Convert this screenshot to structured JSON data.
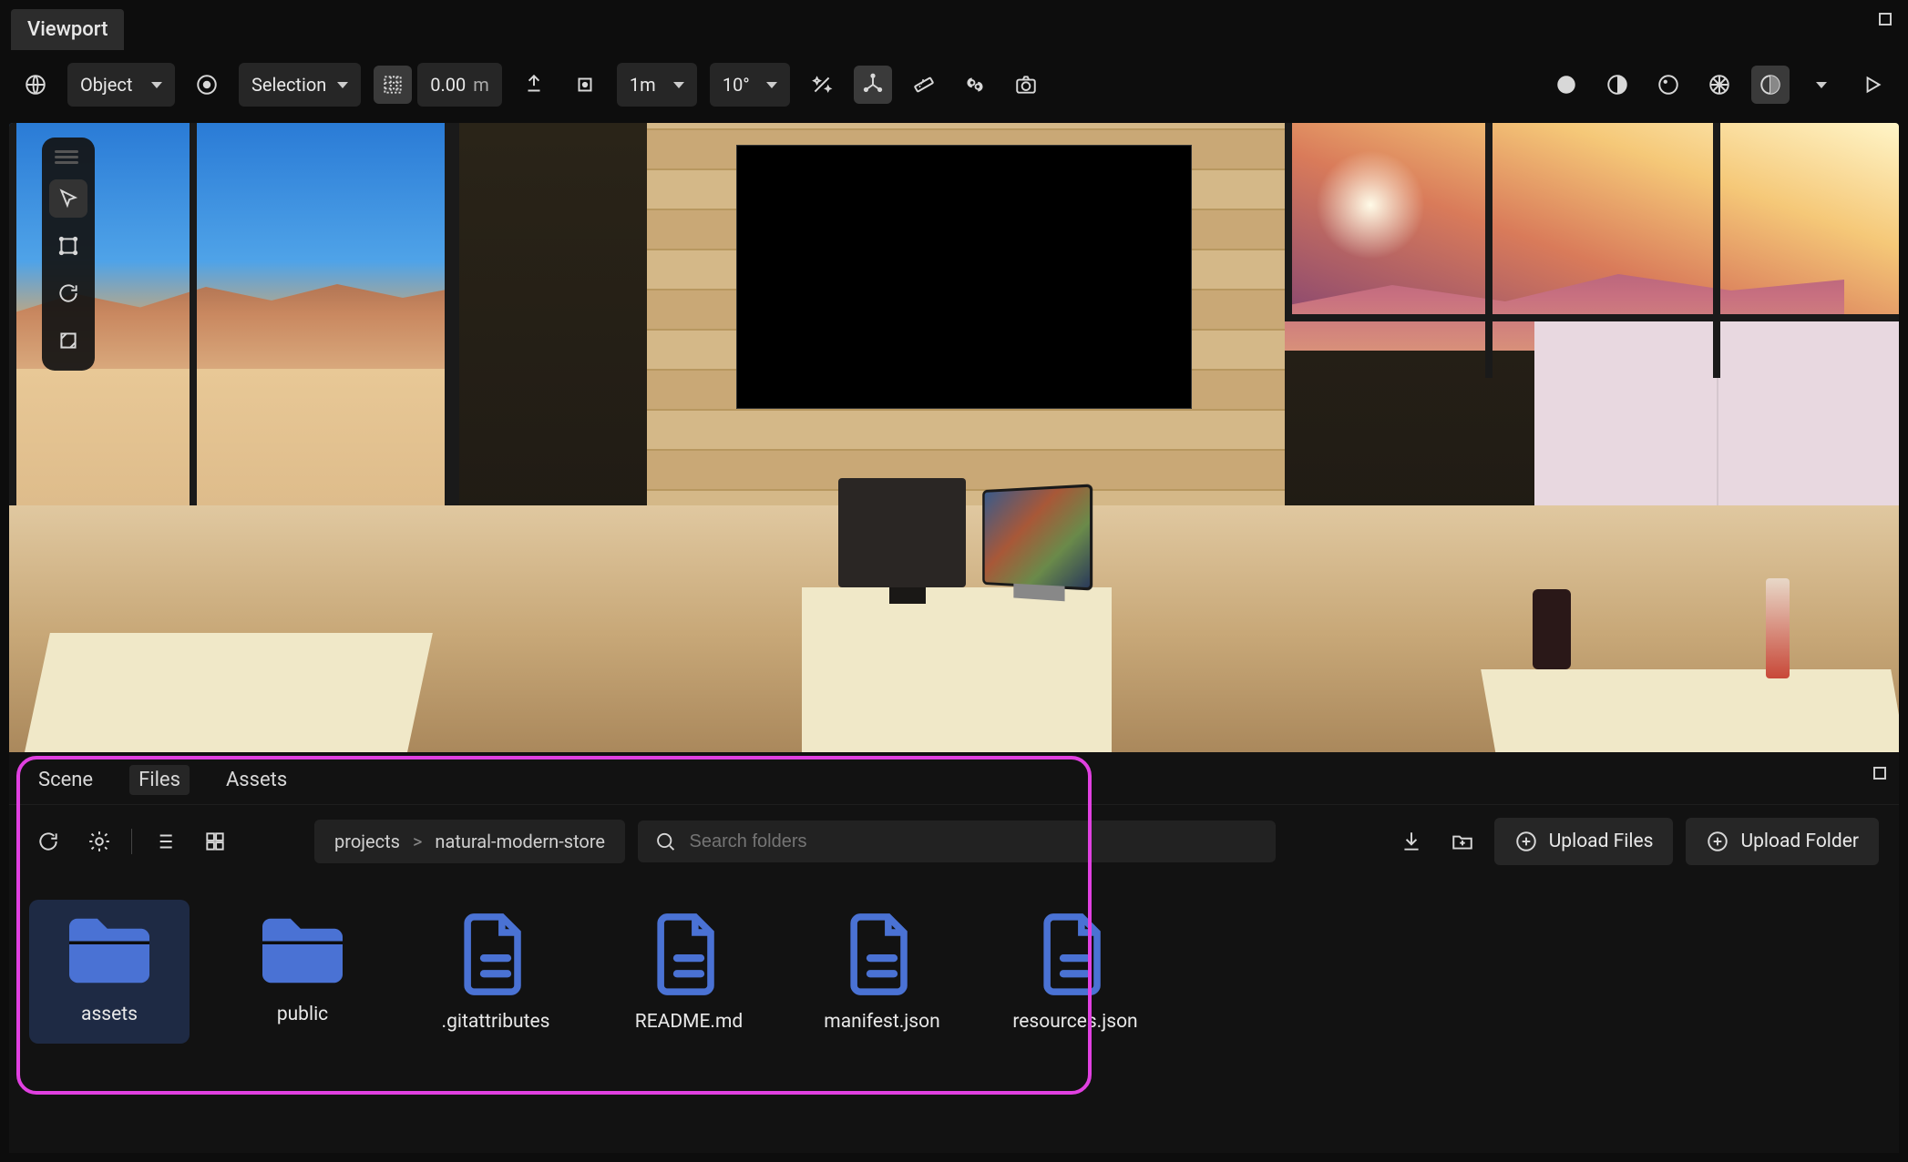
{
  "header": {
    "tab_label": "Viewport"
  },
  "toolbar": {
    "transform_space": "Object",
    "pivot_mode": "Selection",
    "grid_value": "0.00",
    "grid_unit": "m",
    "snap_distance": "1m",
    "snap_angle": "10°"
  },
  "bottom": {
    "tabs": {
      "scene": "Scene",
      "files": "Files",
      "assets": "Assets"
    },
    "breadcrumb": {
      "root": "projects",
      "sep": ">",
      "leaf": "natural-modern-store"
    },
    "search_placeholder": "Search folders",
    "upload_files_label": "Upload Files",
    "upload_folder_label": "Upload Folder",
    "items": [
      {
        "name": "assets",
        "type": "folder",
        "selected": true
      },
      {
        "name": "public",
        "type": "folder",
        "selected": false
      },
      {
        "name": ".gitattributes",
        "type": "file",
        "selected": false
      },
      {
        "name": "README.md",
        "type": "file",
        "selected": false
      },
      {
        "name": "manifest.json",
        "type": "file",
        "selected": false
      },
      {
        "name": "resources.json",
        "type": "file",
        "selected": false
      }
    ]
  },
  "colors": {
    "file_icon": "#4a72d4",
    "annotation": "#e040e0"
  }
}
